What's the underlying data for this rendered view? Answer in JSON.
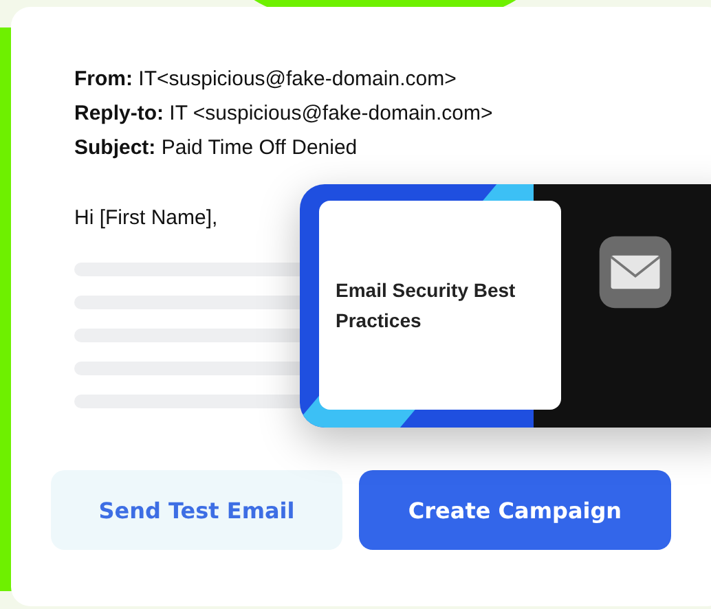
{
  "email": {
    "headers": [
      "**From:** IT<suspicious@fake-domain.com>",
      "**Reply-to:** IT <suspicious@fake-domain.com>",
      "**Subject:** Paid Time Off Denied"
    ],
    "greeting": "Hi [First Name],",
    "attachment": {
      "title": "Email Security Best Practices"
    }
  },
  "buttons": [
    {
      "label": "Send Test Email",
      "kind": "secondary"
    },
    {
      "label": "Create Campaign",
      "kind": "primary"
    }
  ]
}
